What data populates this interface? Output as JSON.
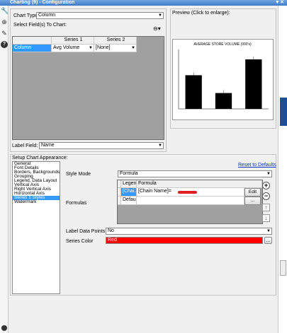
{
  "window": {
    "title": "Charting (9) - Configuration"
  },
  "chart_type": {
    "label": "Chart Type:",
    "value": "Column"
  },
  "select_fields": {
    "label": "Select Field(s) To Chart:"
  },
  "series_grid": {
    "headers": [
      "Series 1",
      "Series 2"
    ],
    "rows": [
      {
        "label": "Column",
        "series1": "Avg Volume",
        "series2": "[None]"
      }
    ]
  },
  "label_field": {
    "label": "Label Field:",
    "value": "Name"
  },
  "preview": {
    "label": "Preview (Click to enlarge):",
    "chart_data": {
      "type": "bar",
      "title": "AVERAGE STORE VOLUME (000's)",
      "categories": [
        "",
        "",
        ""
      ],
      "values": [
        3.4,
        1.6,
        5.0
      ],
      "ylim": [
        0,
        6
      ],
      "grid": false,
      "colors": {
        "bar": "#000000"
      }
    }
  },
  "setup": {
    "label": "Setup Chart Appearance:",
    "items": [
      "General",
      "Font Details",
      "Borders, Backgrounds",
      "Grouping",
      "Legend, Data Layout",
      "Vertical Axis",
      "Right Vertical Axis",
      "Horizontal Axis",
      "Series 1 Styles",
      "Watermark"
    ],
    "selected": "Series 1 Styles"
  },
  "reset_link": "Reset to Defaults",
  "style_mode": {
    "label": "Style Mode",
    "value": "Formula"
  },
  "formulas": {
    "label": "Formulas",
    "headers": [
      "Legend",
      "Formula"
    ],
    "rows": [
      {
        "legend": "[Chai...",
        "formula": "[Chain Name]=",
        "edit": "Edit"
      },
      {
        "legend": "Default",
        "formula": "",
        "edit": "..."
      }
    ]
  },
  "label_points": {
    "label": "Label Data Points",
    "value": "No"
  },
  "series_color": {
    "label": "Series Color",
    "value": "Red",
    "color": "#ff0000",
    "button": "..."
  },
  "buttons": {
    "add": "+",
    "remove": "−",
    "up": "↑",
    "down": "↓"
  }
}
